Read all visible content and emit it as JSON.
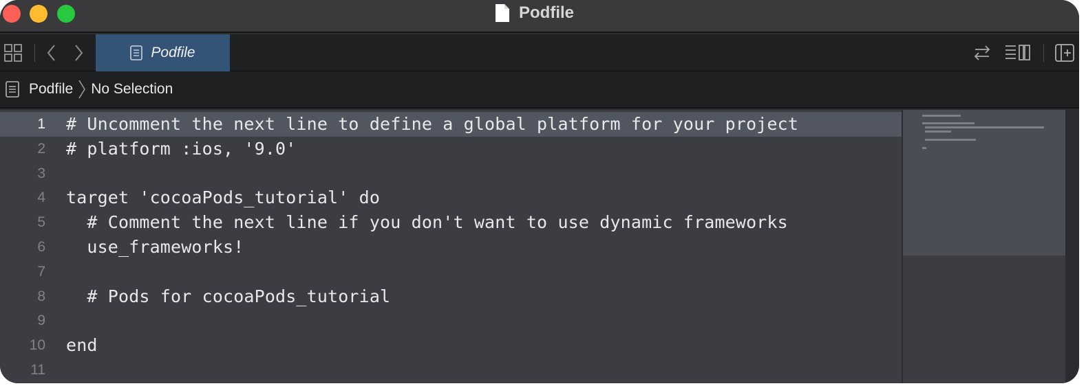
{
  "window": {
    "title": "Podfile",
    "title_icon": "document-icon"
  },
  "tabbar": {
    "active_tab_label": "Podfile",
    "icons": [
      "grid-icon",
      "chevron-left-icon",
      "chevron-right-icon",
      "swap-arrows-icon",
      "inspector-lines-icon",
      "add-editor-icon"
    ]
  },
  "jumpbar": {
    "file": "Podfile",
    "selection": "No Selection"
  },
  "editor": {
    "current_line": 1,
    "lines": [
      {
        "number": "1",
        "text": "# Uncomment the next line to define a global platform for your project"
      },
      {
        "number": "2",
        "text": "# platform :ios, '9.0'"
      },
      {
        "number": "3",
        "text": ""
      },
      {
        "number": "4",
        "text": "target 'cocoaPods_tutorial' do"
      },
      {
        "number": "5",
        "text": "  # Comment the next line if you don't want to use dynamic frameworks"
      },
      {
        "number": "6",
        "text": "  use_frameworks!"
      },
      {
        "number": "7",
        "text": ""
      },
      {
        "number": "8",
        "text": "  # Pods for cocoaPods_tutorial"
      },
      {
        "number": "9",
        "text": ""
      },
      {
        "number": "10",
        "text": "end"
      },
      {
        "number": "11",
        "text": ""
      }
    ]
  },
  "colors": {
    "tab_active": "#335377",
    "current_line": "#515660",
    "editor_bg": "#3b3d42",
    "traffic_close": "#fe5f57",
    "traffic_minimize": "#febc2e",
    "traffic_maximize": "#28c840"
  }
}
